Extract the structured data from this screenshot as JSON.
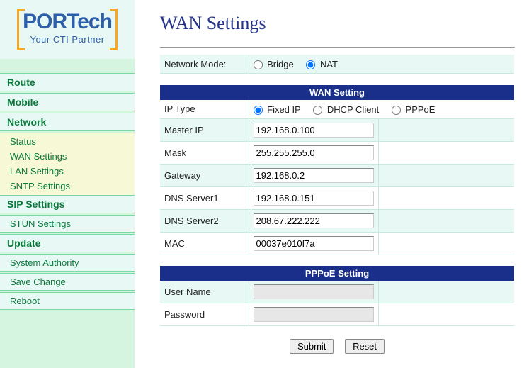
{
  "brand": {
    "name": "PORTech",
    "tagline": "Your CTI Partner"
  },
  "sidebar": {
    "route": "Route",
    "mobile": "Mobile",
    "network": "Network",
    "network_items": {
      "status": "Status",
      "wan": "WAN Settings",
      "lan": "LAN Settings",
      "sntp": "SNTP Settings"
    },
    "sip": "SIP Settings",
    "stun": "STUN Settings",
    "update": "Update",
    "sys_auth": "System Authority",
    "save_change": "Save Change",
    "reboot": "Reboot"
  },
  "page": {
    "title": "WAN Settings",
    "network_mode_label": "Network Mode:",
    "network_mode": {
      "bridge": "Bridge",
      "nat": "NAT",
      "selected": "NAT"
    },
    "wan_section_title": "WAN Setting",
    "ip_type_label": "IP Type",
    "ip_type": {
      "fixed": "Fixed IP",
      "dhcp": "DHCP Client",
      "pppoe": "PPPoE",
      "selected": "Fixed IP"
    },
    "fields": {
      "master_ip": {
        "label": "Master IP",
        "value": "192.168.0.100"
      },
      "mask": {
        "label": "Mask",
        "value": "255.255.255.0"
      },
      "gateway": {
        "label": "Gateway",
        "value": "192.168.0.2"
      },
      "dns1": {
        "label": "DNS Server1",
        "value": "192.168.0.151"
      },
      "dns2": {
        "label": "DNS Server2",
        "value": "208.67.222.222"
      },
      "mac": {
        "label": "MAC",
        "value": "00037e010f7a"
      }
    },
    "pppoe_section_title": "PPPoE Setting",
    "pppoe": {
      "user": {
        "label": "User Name",
        "value": ""
      },
      "pass": {
        "label": "Password",
        "value": ""
      }
    },
    "buttons": {
      "submit": "Submit",
      "reset": "Reset"
    }
  }
}
